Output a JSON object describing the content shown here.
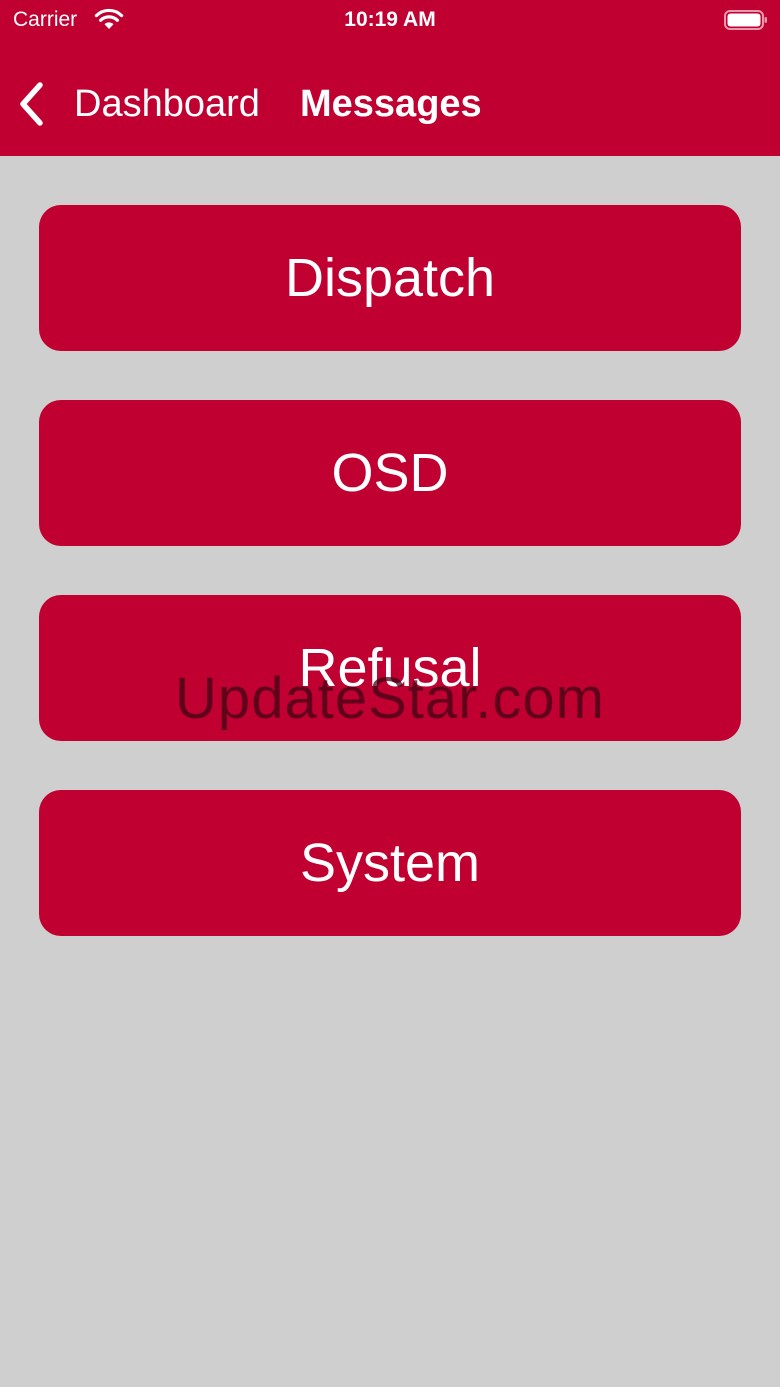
{
  "status_bar": {
    "carrier": "Carrier",
    "time": "10:19 AM",
    "wifi_icon": "wifi-icon",
    "battery_icon": "battery-full-icon"
  },
  "nav": {
    "back_label": "Dashboard",
    "back_icon": "chevron-left-icon",
    "title": "Messages"
  },
  "menu": {
    "items": [
      {
        "label": "Dispatch"
      },
      {
        "label": "OSD"
      },
      {
        "label": "Refusal"
      },
      {
        "label": "System"
      }
    ]
  },
  "watermark": {
    "text": "UpdateStar.com"
  },
  "colors": {
    "brand_red": "#c00030",
    "background": "#cfcfcf",
    "text_on_brand": "#ffffff"
  }
}
